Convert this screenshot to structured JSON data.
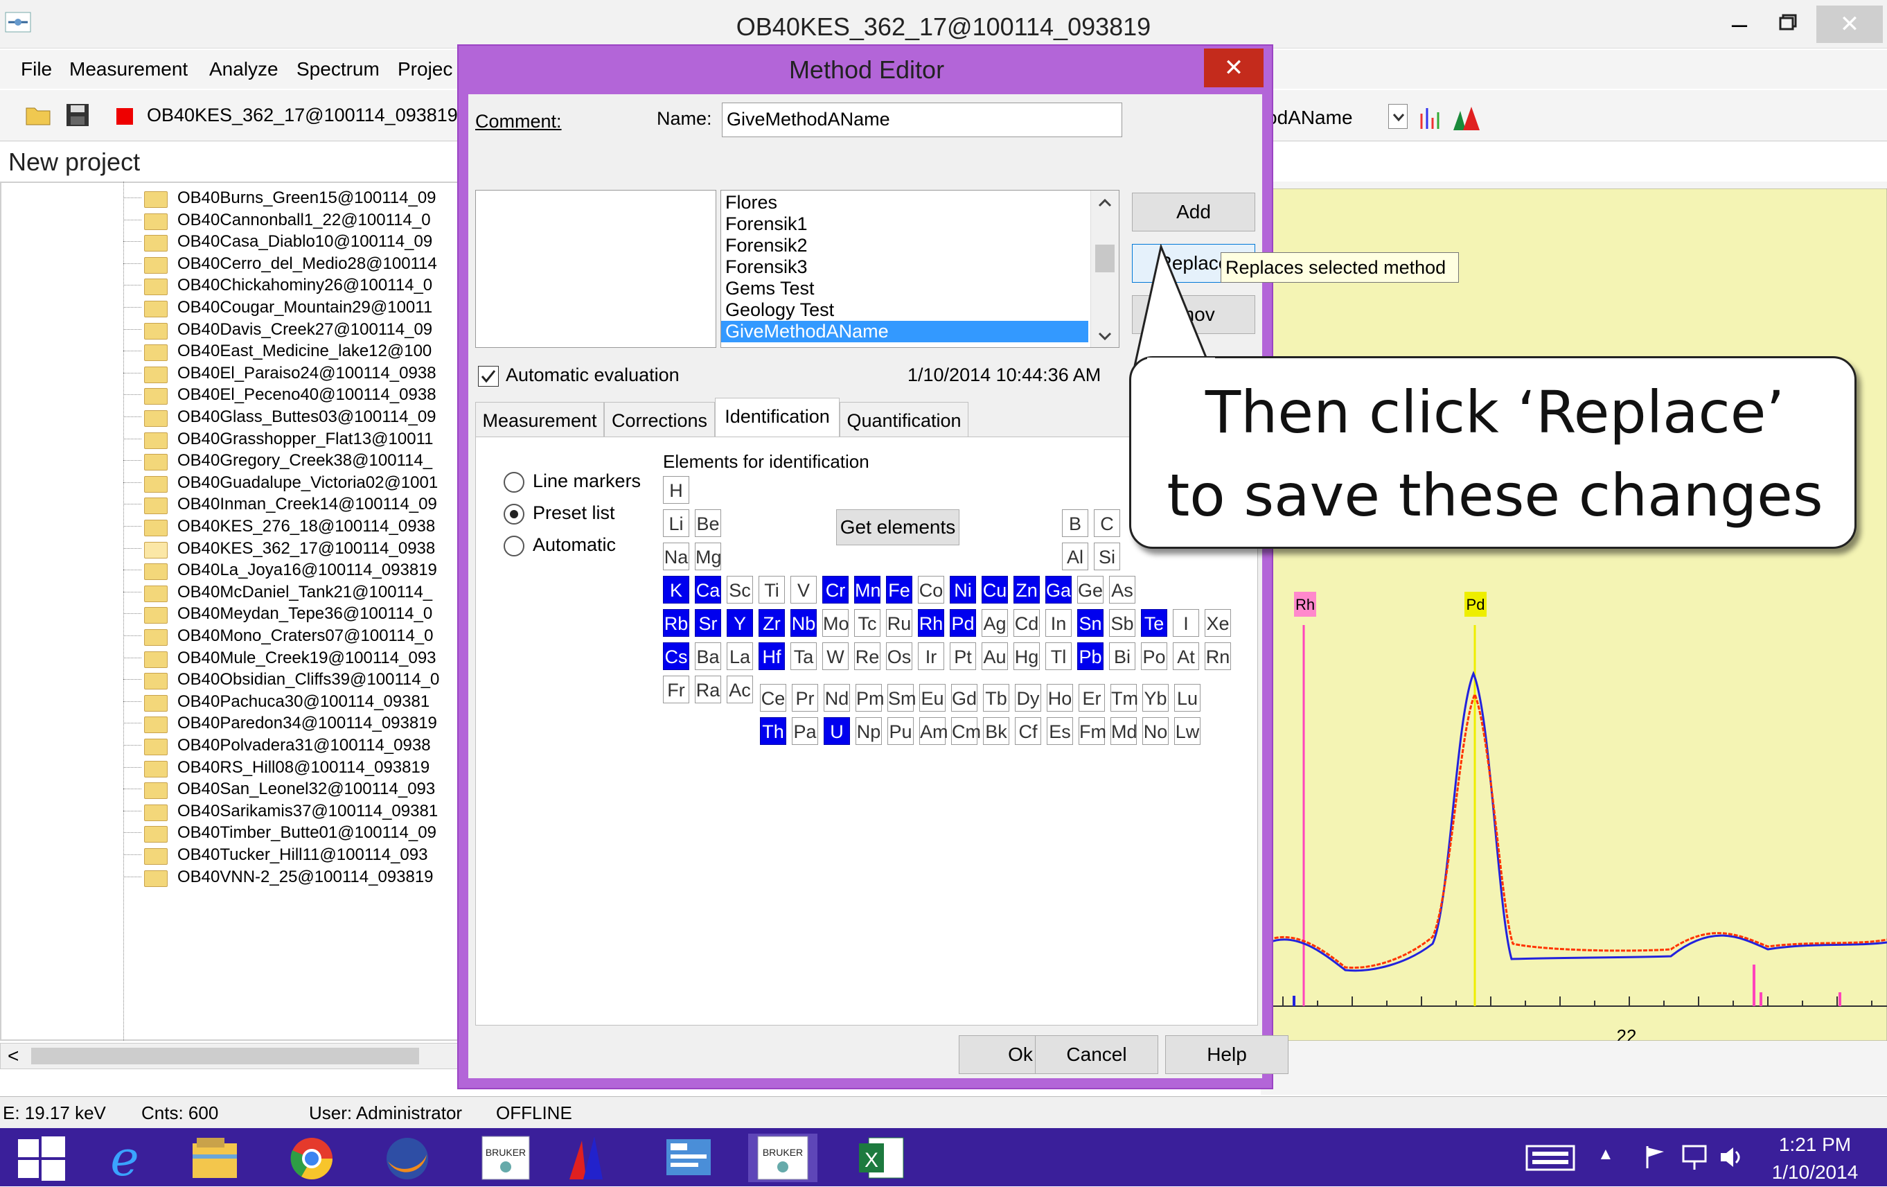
{
  "window": {
    "title": "OB40KES_362_17@100114_093819",
    "minimize": "–",
    "close": "✕"
  },
  "menu": [
    "File",
    "Measurement",
    "Analyze",
    "Spectrum",
    "Projec"
  ],
  "toolbar": {
    "spectrum_name": "OB40KES_362_17@100114_093819",
    "method_select_partial": "odAName"
  },
  "project": {
    "title": "New project",
    "items": [
      "OB40Burns_Green15@100114_09",
      "OB40Cannonball1_22@100114_0",
      "OB40Casa_Diablo10@100114_09",
      "OB40Cerro_del_Medio28@100114",
      "OB40Chickahominy26@100114_0",
      "OB40Cougar_Mountain29@10011",
      "OB40Davis_Creek27@100114_09",
      "OB40East_Medicine_lake12@100",
      "OB40El_Paraiso24@100114_0938",
      "OB40El_Peceno40@100114_0938",
      "OB40Glass_Buttes03@100114_09",
      "OB40Grasshopper_Flat13@10011",
      "OB40Gregory_Creek38@100114_",
      "OB40Guadalupe_Victoria02@1001",
      "OB40Inman_Creek14@100114_09",
      "OB40KES_276_18@100114_0938",
      "OB40KES_362_17@100114_0938",
      "OB40La_Joya16@100114_093819",
      "OB40McDaniel_Tank21@100114_",
      "OB40Meydan_Tepe36@100114_0",
      "OB40Mono_Craters07@100114_0",
      "OB40Mule_Creek19@100114_093",
      "OB40Obsidian_Cliffs39@100114_0",
      "OB40Pachuca30@100114_09381",
      "OB40Paredon34@100114_093819",
      "OB40Polvadera31@100114_0938",
      "OB40RS_Hill08@100114_093819",
      "OB40San_Leonel32@100114_093",
      "OB40Sarikamis37@100114_09381",
      "OB40Timber_Butte01@100114_09",
      "OB40Tucker_Hill11@100114_093",
      "OB40VNN-2_25@100114_093819"
    ],
    "open_index": 16
  },
  "status": {
    "energy": "E: 19.17 keV",
    "counts": "Cnts: 600",
    "user": "User: Administrator",
    "mode": "OFFLINE"
  },
  "dialog": {
    "title": "Method Editor",
    "close": "✕",
    "comment_label": "Comment:",
    "name_label": "Name:",
    "name_value": "GiveMethodAName",
    "methods": [
      "Flores",
      "Forensik1",
      "Forensik2",
      "Forensik3",
      "Gems Test",
      "Geology Test",
      "GiveMethodAName"
    ],
    "selected_method_index": 6,
    "add": "Add",
    "replace": "Replace",
    "remove_partial": "Remov",
    "auto_eval": "Automatic evaluation",
    "timestamp": "1/10/2014 10:44:36 AM",
    "tabs": [
      "Measurement",
      "Corrections",
      "Identification",
      "Quantification"
    ],
    "active_tab": 2,
    "elements_label": "Elements for identification",
    "radios": [
      "Line markers",
      "Preset list",
      "Automatic"
    ],
    "radio_selected": 1,
    "get_elements": "Get elements",
    "ok": "Ok",
    "cancel": "Cancel",
    "help": "Help"
  },
  "tooltip": "Replaces selected method",
  "callout": {
    "line1": "Then click ‘Replace’",
    "line2": "to save these changes"
  },
  "graph": {
    "markers": [
      "Rh",
      "Pd"
    ],
    "x_tick": "22",
    "colors": {
      "background": "#f4f4b4",
      "series1": "#2222dd",
      "series2": "#ff3300",
      "rh": "#ff44bb",
      "pd": "#eeee00"
    }
  },
  "taskbar": {
    "time": "1:21 PM",
    "date": "1/10/2014",
    "tray_up": "▲"
  }
}
